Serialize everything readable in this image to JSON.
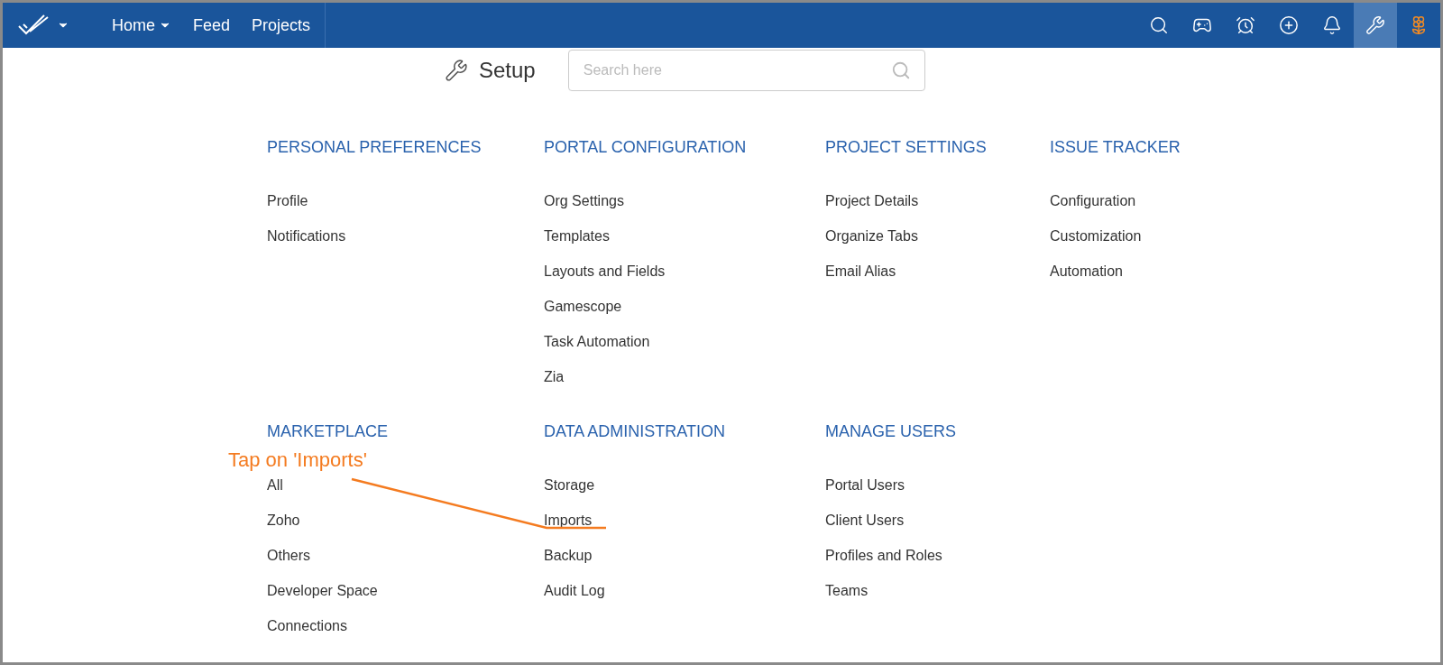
{
  "nav": {
    "items": [
      {
        "label": "Home",
        "dropdown": true
      },
      {
        "label": "Feed",
        "dropdown": false
      },
      {
        "label": "Projects",
        "dropdown": false
      }
    ],
    "toolbar": [
      {
        "kind": "search",
        "selected": false
      },
      {
        "kind": "gamepad",
        "selected": false
      },
      {
        "kind": "alarm",
        "selected": false
      },
      {
        "kind": "add",
        "selected": false
      },
      {
        "kind": "bell",
        "selected": false
      },
      {
        "kind": "tools",
        "selected": true
      },
      {
        "kind": "lotus",
        "selected": false
      }
    ]
  },
  "setup": {
    "title": "Setup",
    "search": {
      "placeholder": "Search here"
    }
  },
  "sections": [
    {
      "heading": "PERSONAL PREFERENCES",
      "items": [
        "Profile",
        "Notifications"
      ]
    },
    {
      "heading": "PORTAL CONFIGURATION",
      "items": [
        "Org Settings",
        "Templates",
        "Layouts and Fields",
        "Gamescope",
        "Task Automation",
        "Zia"
      ]
    },
    {
      "heading": "PROJECT SETTINGS",
      "items": [
        "Project Details",
        "Organize Tabs",
        "Email Alias"
      ]
    },
    {
      "heading": "ISSUE TRACKER",
      "items": [
        "Configuration",
        "Customization",
        "Automation"
      ]
    },
    {
      "heading": "MARKETPLACE",
      "items": [
        "All",
        "Zoho",
        "Others",
        "Developer Space",
        "Connections"
      ]
    },
    {
      "heading": "DATA ADMINISTRATION",
      "items": [
        "Storage",
        "Imports",
        "Backup",
        "Audit Log"
      ]
    },
    {
      "heading": "MANAGE USERS",
      "items": [
        "Portal Users",
        "Client Users",
        "Profiles and Roles",
        "Teams"
      ]
    }
  ],
  "annotation": {
    "text": "Tap on 'Imports'"
  }
}
